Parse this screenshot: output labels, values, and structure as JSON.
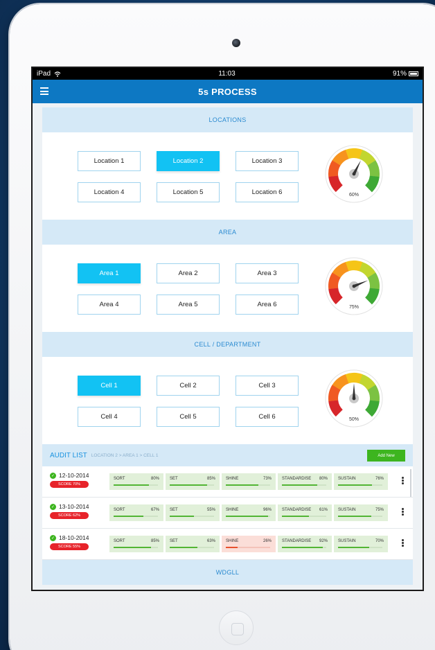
{
  "status_bar": {
    "device": "iPad",
    "time": "11:03",
    "battery": "91%"
  },
  "header": {
    "title": "5s PROCESS"
  },
  "sections": [
    {
      "title": "LOCATIONS",
      "options": [
        "Location 1",
        "Location 2",
        "Location 3",
        "Location 4",
        "Location 5",
        "Location 6"
      ],
      "selected": 1,
      "gauge": {
        "label": "60%",
        "value": 60
      }
    },
    {
      "title": "AREA",
      "options": [
        "Area 1",
        "Area 2",
        "Area 3",
        "Area 4",
        "Area 5",
        "Area 6"
      ],
      "selected": 0,
      "gauge": {
        "label": "75%",
        "value": 75
      }
    },
    {
      "title": "CELL / DEPARTMENT",
      "options": [
        "Cell 1",
        "Cell 2",
        "Cell 3",
        "Cell 4",
        "Cell 5",
        "Cell 6"
      ],
      "selected": 0,
      "gauge": {
        "label": "50%",
        "value": 50
      }
    }
  ],
  "audit": {
    "title": "AUDIT LIST",
    "breadcrumb": "LOCATION 2 > AREA 1 > CELL 1",
    "add_label": "Add New",
    "rows": [
      {
        "date": "12-10-2014",
        "score": "SCORE 70%",
        "metrics": [
          {
            "name": "SORT",
            "value": "80%",
            "pct": 80
          },
          {
            "name": "SET",
            "value": "85%",
            "pct": 85
          },
          {
            "name": "SHINE",
            "value": "73%",
            "pct": 73
          },
          {
            "name": "STANDARDISE",
            "value": "80%",
            "pct": 80
          },
          {
            "name": "SUSTAIN",
            "value": "76%",
            "pct": 76
          }
        ]
      },
      {
        "date": "13-10-2014",
        "score": "SCORE 62%",
        "metrics": [
          {
            "name": "SORT",
            "value": "67%",
            "pct": 67
          },
          {
            "name": "SET",
            "value": "55%",
            "pct": 55
          },
          {
            "name": "SHINE",
            "value": "96%",
            "pct": 96
          },
          {
            "name": "STANDARDISE",
            "value": "61%",
            "pct": 61
          },
          {
            "name": "SUSTAIN",
            "value": "75%",
            "pct": 75
          }
        ]
      },
      {
        "date": "18-10-2014",
        "score": "SCORE 55%",
        "metrics": [
          {
            "name": "SORT",
            "value": "85%",
            "pct": 85
          },
          {
            "name": "SET",
            "value": "63%",
            "pct": 63
          },
          {
            "name": "SHINE",
            "value": "26%",
            "pct": 26,
            "warn": true
          },
          {
            "name": "STANDARDISE",
            "value": "92%",
            "pct": 92
          },
          {
            "name": "SUSTAIN",
            "value": "70%",
            "pct": 70
          }
        ]
      }
    ]
  },
  "footer_section": {
    "title": "WDGLL"
  },
  "colors": {
    "primary": "#0d78c3",
    "accent": "#12c2f3",
    "success": "#3db51f",
    "danger": "#e7232a"
  }
}
